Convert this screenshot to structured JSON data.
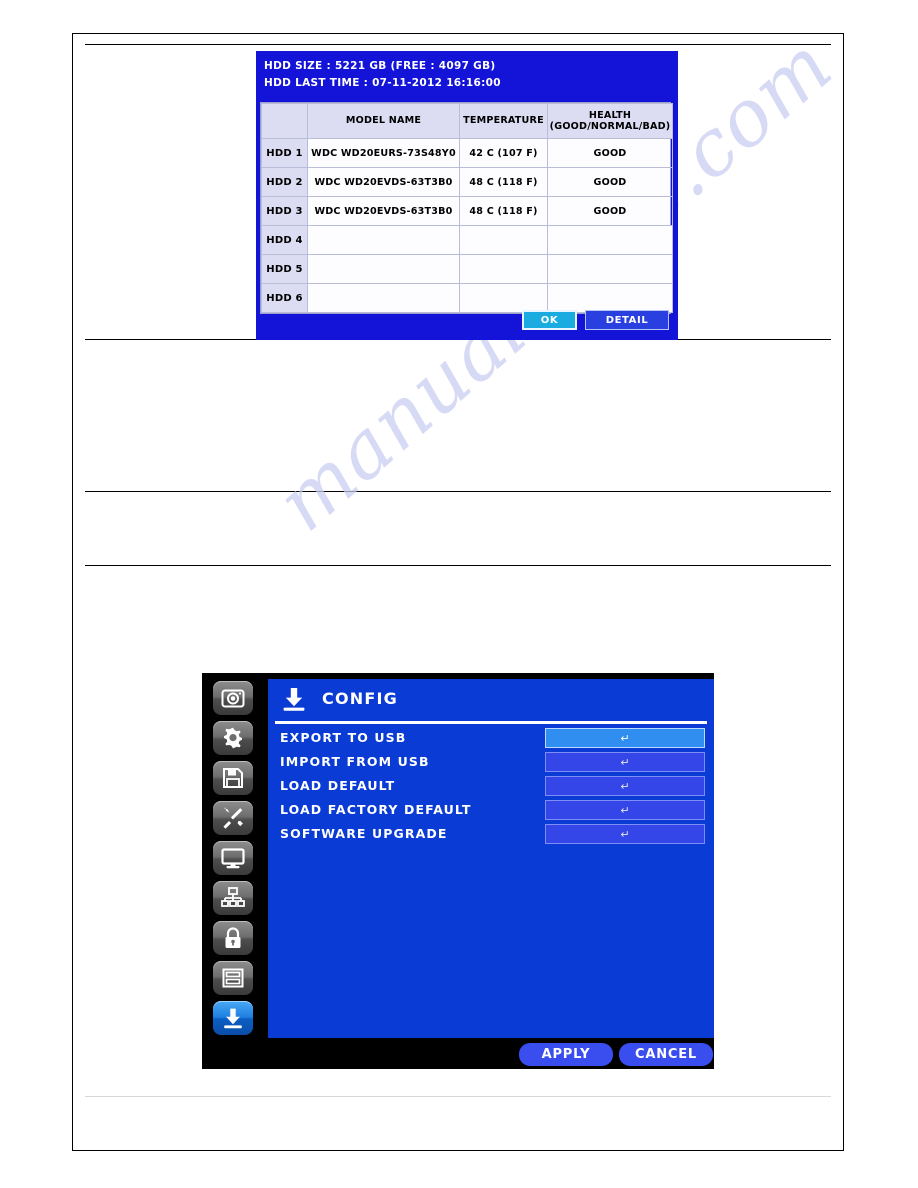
{
  "page": {
    "watermark": "manualshive.com"
  },
  "hdd_dialog": {
    "size_line": "HDD SIZE : 5221 GB (FREE : 4097 GB)",
    "last_time_line": "HDD LAST TIME : 07-11-2012 16:16:00",
    "columns": [
      "",
      "MODEL  NAME",
      "TEMPERATURE",
      "HEALTH",
      "(GOOD/NORMAL/BAD)"
    ],
    "rows": [
      {
        "id": "HDD 1",
        "model": "WDC  WD20EURS-73S48Y0",
        "temperature": "42 C  (107 F)",
        "health": "GOOD"
      },
      {
        "id": "HDD 2",
        "model": "WDC  WD20EVDS-63T3B0",
        "temperature": "48 C  (118 F)",
        "health": "GOOD"
      },
      {
        "id": "HDD 3",
        "model": "WDC  WD20EVDS-63T3B0",
        "temperature": "48 C  (118 F)",
        "health": "GOOD"
      },
      {
        "id": "HDD 4",
        "model": "",
        "temperature": "",
        "health": ""
      },
      {
        "id": "HDD 5",
        "model": "",
        "temperature": "",
        "health": ""
      },
      {
        "id": "HDD 6",
        "model": "",
        "temperature": "",
        "health": ""
      }
    ],
    "buttons": {
      "ok": "OK",
      "detail": "DETAIL"
    }
  },
  "config_dialog": {
    "title": "CONFIG",
    "sidebar_icons": [
      "camera-icon",
      "gear-icon",
      "floppy-disk-icon",
      "tools-icon",
      "monitor-icon",
      "network-icon",
      "lock-icon",
      "storage-icon",
      "config-download-icon"
    ],
    "menu_rows": [
      {
        "label": "EXPORT  TO  USB",
        "value": "↵",
        "highlighted": true
      },
      {
        "label": "IMPORT  FROM  USB",
        "value": "↵",
        "highlighted": false
      },
      {
        "label": "LOAD  DEFAULT",
        "value": "↵",
        "highlighted": false
      },
      {
        "label": "LOAD  FACTORY  DEFAULT",
        "value": "↵",
        "highlighted": false
      },
      {
        "label": "SOFTWARE  UPGRADE",
        "value": "↵",
        "highlighted": false
      }
    ],
    "buttons": {
      "apply": "APPLY",
      "cancel": "CANCEL"
    }
  },
  "colors": {
    "dialog_blue": "#1414d8",
    "osd_blue": "#0a3bd4",
    "highlight_blue": "#2f8ef0",
    "button_blue": "#3a4ef0",
    "ok_cyan": "#1aace0",
    "watermark": "#c9cdf0"
  }
}
